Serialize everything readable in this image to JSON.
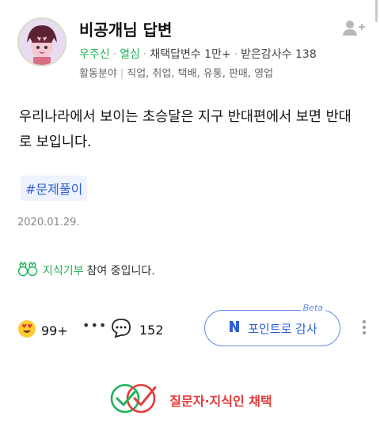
{
  "profile": {
    "name": "비공개님 답변",
    "grade": "우주신",
    "level": "열심",
    "adopt_label": "채택답변수",
    "adopt_count": "1만+",
    "thanks_label": "받은감사수",
    "thanks_count": "138",
    "field_label": "활동분야",
    "fields": "직업, 취업, 택배, 유통, 판매, 영업"
  },
  "answer": {
    "text": "우리나라에서 보이는 초승달은 지구 반대편에서 보면 반대로 보입니다.",
    "tag": "#문제풀이",
    "date": "2020.01.29."
  },
  "jisik": {
    "brand": "지식기부",
    "text": "참여 중입니다."
  },
  "actions": {
    "reaction_count": "99+",
    "more": "•••",
    "comment_count": "152",
    "thanks_button": "포인트로 감사",
    "beta": "Beta"
  },
  "choose": {
    "label": "질문자·지식인 채택"
  },
  "colors": {
    "green": "#1fb35a",
    "blue": "#2f5fd9",
    "red": "#e23b3b"
  }
}
